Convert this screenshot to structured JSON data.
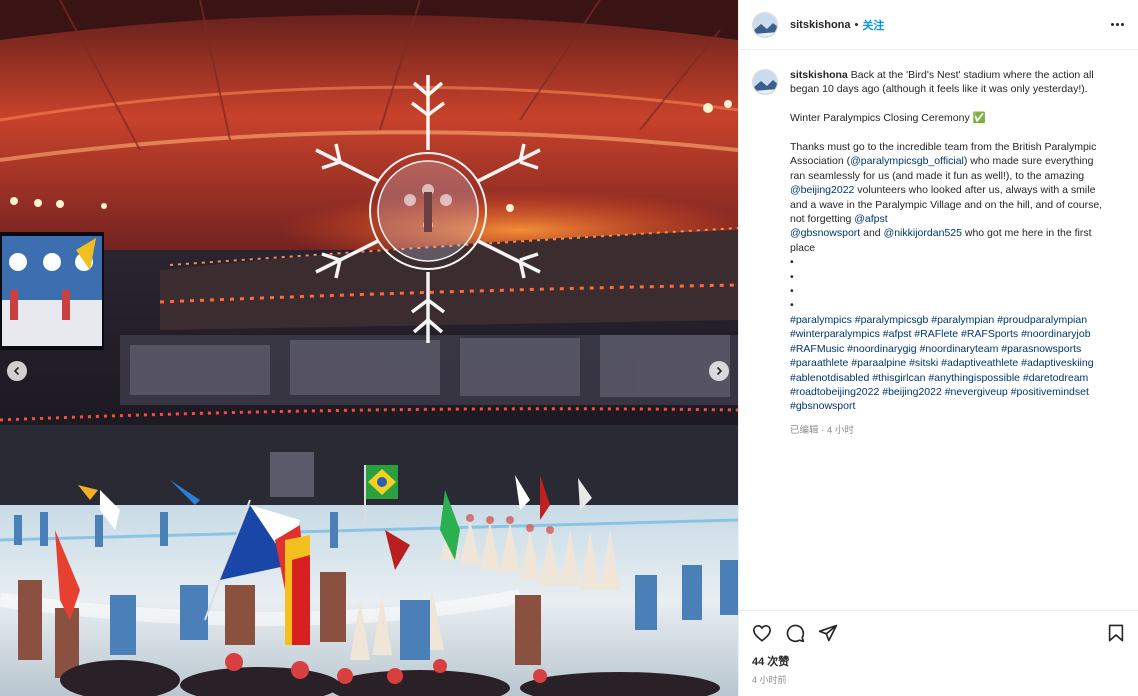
{
  "post": {
    "username": "sitskishona",
    "separator": "•",
    "follow_label": "关注",
    "more_icon": "more-horizontal-icon"
  },
  "caption": {
    "username": "sitskishona",
    "lines": [
      [
        {
          "t": "Back at the 'Bird's Nest' stadium where the action all"
        }
      ],
      [
        {
          "t": "began 10 days ago (although it feels like it was only yesterday!)."
        }
      ],
      [],
      [
        {
          "t": "Winter Paralympics Closing Ceremony ✅"
        }
      ],
      [],
      [
        {
          "t": "Thanks must go to the incredible team from the British Paralympic"
        }
      ],
      [
        {
          "t": "Association ("
        },
        {
          "t": "@paralympicsgb_official",
          "l": 1
        },
        {
          "t": ") who made sure everything"
        }
      ],
      [
        {
          "t": "ran seamlessly for us (and made it fun as well!), to the amazing"
        }
      ],
      [
        {
          "t": "@beijing2022",
          "l": 1
        },
        {
          "t": " volunteers who looked after us, always with a smile"
        }
      ],
      [
        {
          "t": "and a wave in the Paralympic Village and on the hill, and of course,"
        }
      ],
      [
        {
          "t": "not forgetting "
        },
        {
          "t": "@afpst",
          "l": 1
        }
      ],
      [
        {
          "t": "@gbsnowsport",
          "l": 1
        },
        {
          "t": " and "
        },
        {
          "t": "@nikkijordan525",
          "l": 1
        },
        {
          "t": " who got me here in the first"
        }
      ],
      [
        {
          "t": "place"
        }
      ],
      [
        {
          "t": "•"
        }
      ],
      [
        {
          "t": "•"
        }
      ],
      [
        {
          "t": "•"
        }
      ],
      [
        {
          "t": "•"
        }
      ],
      [
        {
          "t": "#paralympics #paralympicsgb #paralympian #proudparalympian",
          "l": 1
        }
      ],
      [
        {
          "t": "#winterparalympics #afpst #RAFlete #RAFSports #noordinaryjob",
          "l": 1
        }
      ],
      [
        {
          "t": "#RAFMusic #noordinarygig #noordinaryteam #parasnowsports",
          "l": 1
        }
      ],
      [
        {
          "t": "#paraathlete #paraalpine #sitski #adaptiveathlete #adaptiveskiing",
          "l": 1
        }
      ],
      [
        {
          "t": "#ablenotdisabled #thisgirlcan #anythingispossible #daretodream",
          "l": 1
        }
      ],
      [
        {
          "t": "#roadtobeijing2022 #beijing2022 #nevergiveup #positivemindset",
          "l": 1
        }
      ],
      [
        {
          "t": "#gbsnowsport",
          "l": 1
        }
      ]
    ],
    "edited_meta": "已编辑 · 4 小时"
  },
  "actions": {
    "icons": [
      "heart-icon",
      "comment-icon",
      "share-icon",
      "bookmark-icon"
    ],
    "likes": "44 次赞",
    "time": "4 小时前"
  },
  "media": {
    "description_icons": [
      "chevron-left-icon",
      "chevron-right-icon"
    ]
  }
}
